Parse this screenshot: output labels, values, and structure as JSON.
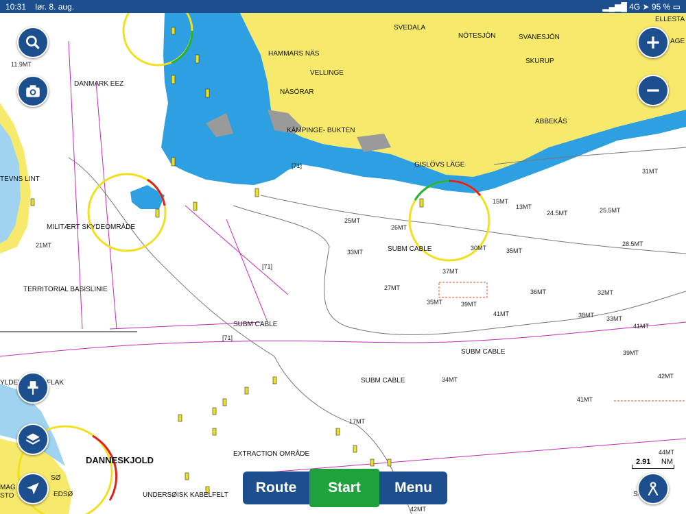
{
  "status_bar": {
    "time": "10:31",
    "date": "lør. 8. aug.",
    "network": "4G",
    "battery": "95 %"
  },
  "map": {
    "land_labels": [
      "SVEDALA",
      "NÖTESJÖN",
      "SVANESJÖN",
      "HAMMARS NÄS",
      "SKURUP",
      "VELLINGE",
      "NÄSÖRAR",
      "ABBEKÅS",
      "KÄMPINGE- BUKTEN",
      "GISLÖVS LÄGE",
      "ELLESTA",
      "AGE",
      "DANMARK EEZ",
      "MILITÆRT SKYDEOMRÅDE",
      "TERRITORIAL BASISLINIE",
      "DANNESKJOLD",
      "EXTRACTION OMRÅDE",
      "UNDERSØISK KABELFELT",
      "TEVNS LINT",
      "YLDEN",
      "FLAK",
      "MAG",
      "STO",
      "SØ",
      "EDSØ",
      "SO"
    ],
    "cable_labels": [
      "SUBM CABLE",
      "SUBM CABLE",
      "SUBM CABLE",
      "SUBM CABLE"
    ],
    "depth_labels": [
      "11.9MT",
      "25MT",
      "26MT",
      "33MT",
      "37MT",
      "27MT",
      "35MT",
      "39MT",
      "41MT",
      "36MT",
      "32MT",
      "38MT",
      "33MT",
      "41MT",
      "39MT",
      "42MT",
      "34MT",
      "41MT",
      "17MT",
      "44MT",
      "42MT",
      "31MT",
      "25.5MT",
      "28.5MT",
      "24.5MT",
      "15MT",
      "13MT",
      "21MT",
      "30MT",
      "35MT"
    ],
    "bracket_labels": [
      "[71]",
      "[71]",
      "[71]"
    ]
  },
  "controls": {
    "zoom_in": "zoom-in",
    "zoom_out": "zoom-out",
    "search": "search",
    "camera": "camera",
    "pin": "pin",
    "layers": "layers",
    "locate": "locate",
    "user": "user"
  },
  "bottom_nav": {
    "route": "Route",
    "start": "Start",
    "menu": "Menu"
  },
  "scale": {
    "value": "2.91",
    "unit": "NM"
  },
  "colors": {
    "land": "#f7e96b",
    "shallow": "#2e9fe0",
    "deep": "#ffffff",
    "button": "#1d4f8f",
    "start": "#1fa23c"
  }
}
